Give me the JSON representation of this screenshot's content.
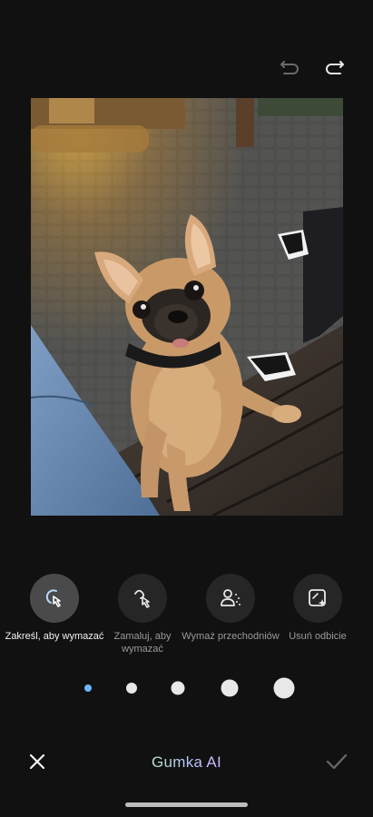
{
  "toolbar": {
    "undo_icon": "undo-icon",
    "redo_icon": "redo-icon"
  },
  "photo": {
    "subject": "french-bulldog-photo"
  },
  "tools": [
    {
      "label": "Zakreśl, aby wymazać",
      "icon": "circle-select-icon",
      "active": true
    },
    {
      "label": "Zamaluj, aby wymazać",
      "icon": "brush-erase-icon",
      "active": false
    },
    {
      "label": "Wymaż przechodniów",
      "icon": "people-erase-icon",
      "active": false
    },
    {
      "label": "Usuń odbicie",
      "icon": "reflection-remove-icon",
      "active": false
    }
  ],
  "brush_sizes": {
    "count": 5,
    "selected_index": 0,
    "accent": "#6fb6ff"
  },
  "bottom": {
    "title": "Gumka AI",
    "close_icon": "close-icon",
    "confirm_icon": "check-icon"
  }
}
